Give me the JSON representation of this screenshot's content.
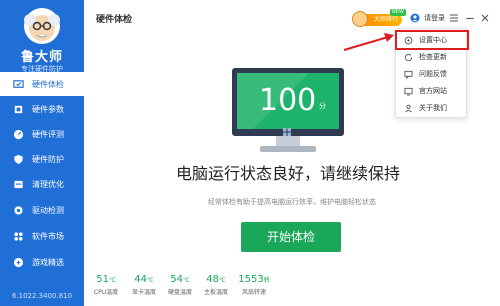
{
  "brand": {
    "name": "鲁大师",
    "subtitle": "专注硬件防护"
  },
  "header": {
    "title": "硬件体检",
    "rank_badge": "大师排行",
    "rank_new": "NEW",
    "login": "请登录"
  },
  "sidebar": {
    "items": [
      {
        "label": "硬件体检",
        "icon": "monitor-check-icon",
        "active": true
      },
      {
        "label": "硬件参数",
        "icon": "cpu-icon"
      },
      {
        "label": "硬件评测",
        "icon": "gauge-icon"
      },
      {
        "label": "硬件防护",
        "icon": "shield-icon"
      },
      {
        "label": "清理优化",
        "icon": "broom-icon"
      },
      {
        "label": "驱动检测",
        "icon": "gear-icon"
      },
      {
        "label": "软件市场",
        "icon": "apps-icon"
      },
      {
        "label": "游戏精选",
        "icon": "gamepad-icon"
      }
    ],
    "version": "6.1022.3400.810"
  },
  "dropdown": {
    "items": [
      {
        "label": "设置中心",
        "icon": "settings-icon"
      },
      {
        "label": "检查更新",
        "icon": "refresh-icon"
      },
      {
        "label": "问题反馈",
        "icon": "feedback-icon"
      },
      {
        "label": "官方网站",
        "icon": "website-icon"
      },
      {
        "label": "关于我们",
        "icon": "about-icon"
      }
    ]
  },
  "monitor": {
    "score": "100",
    "unit": "分"
  },
  "status": {
    "message": "电脑运行状态良好，请继续保持",
    "tip": "经常体检有助于提高电脑运行效率，维护电脑轻松状态"
  },
  "start_button": "开始体检",
  "metrics": [
    {
      "value": "51",
      "unit": "℃",
      "label": "CPU温度"
    },
    {
      "value": "44",
      "unit": "℃",
      "label": "显卡温度"
    },
    {
      "value": "54",
      "unit": "℃",
      "label": "硬盘温度"
    },
    {
      "value": "48",
      "unit": "℃",
      "label": "主板温度"
    },
    {
      "value": "1553",
      "unit": "转",
      "label": "风扇转速"
    }
  ],
  "colors": {
    "sidebar": "#1f6fd6",
    "accent_green": "#1aa75a",
    "highlight_red": "#e01e1e"
  }
}
